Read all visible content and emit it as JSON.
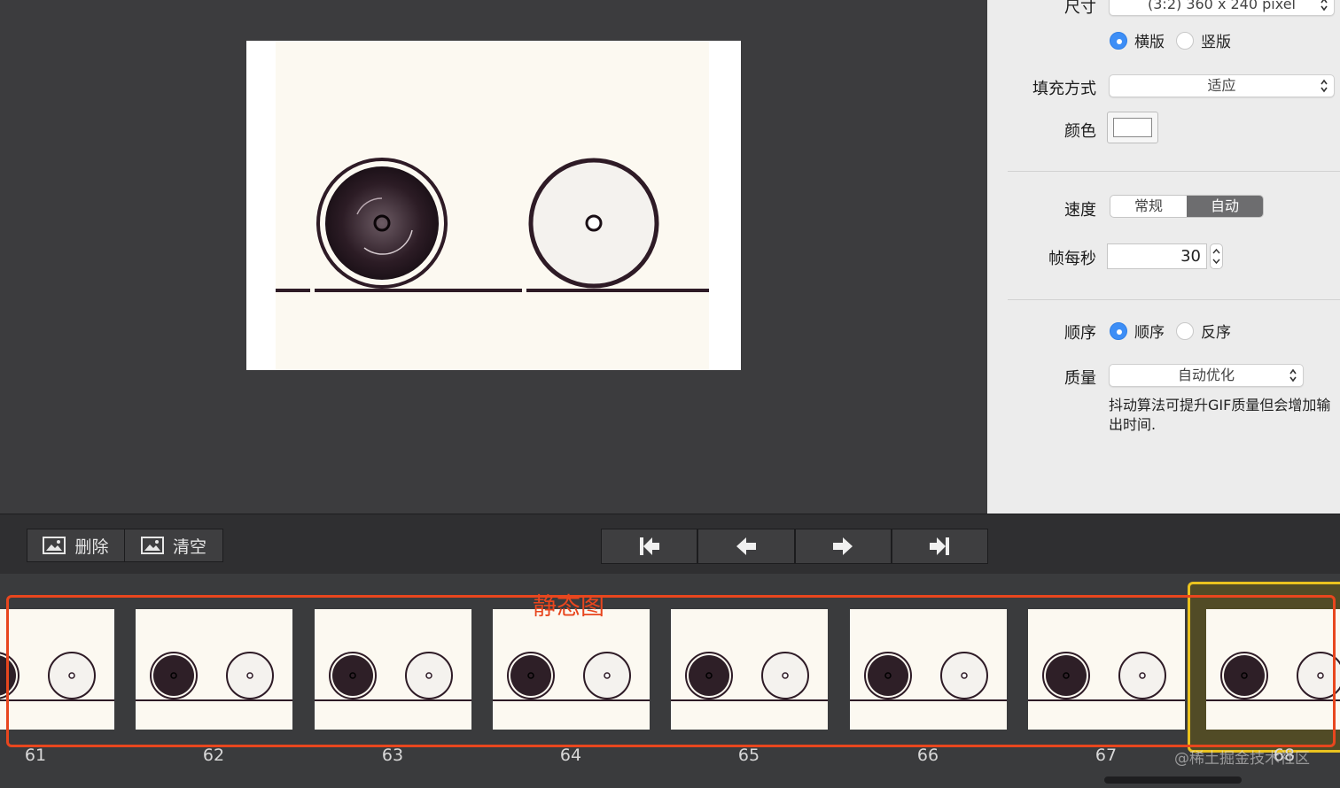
{
  "settings": {
    "size_label": "尺寸",
    "size_value": "(3:2) 360 x 240 pixel",
    "orientation": [
      {
        "label": "横版",
        "selected": true
      },
      {
        "label": "竖版",
        "selected": false
      }
    ],
    "fill_label": "填充方式",
    "fill_value": "适应",
    "color_label": "颜色",
    "color_value": "#ffffff",
    "speed_label": "速度",
    "speed_options": [
      "常规",
      "自动"
    ],
    "speed_selected": "自动",
    "fps_label": "帧每秒",
    "fps_value": "30",
    "order_label": "顺序",
    "order": [
      {
        "label": "顺序",
        "selected": true
      },
      {
        "label": "反序",
        "selected": false
      }
    ],
    "quality_label": "质量",
    "quality_value": "自动优化",
    "quality_note": "抖动算法可提升GIF质量但会增加输出时间."
  },
  "toolbar": {
    "delete_label": "删除",
    "clear_label": "清空",
    "nav_icons": [
      "skip-to-start-icon",
      "previous-frame-icon",
      "next-frame-icon",
      "skip-to-end-icon"
    ]
  },
  "filmstrip": {
    "annotation_label": "静态图",
    "frames": [
      "61",
      "62",
      "63",
      "64",
      "65",
      "66",
      "67",
      "68"
    ],
    "selected_frame": "68",
    "watermark": "@稀土掘金技术社区"
  },
  "colors": {
    "accent": "#3d8ef6",
    "annotation": "#e8461e",
    "selection": "#e9c21f",
    "wheel_outline": "#2e1b26",
    "canvas_bg": "#fcf9f1"
  }
}
